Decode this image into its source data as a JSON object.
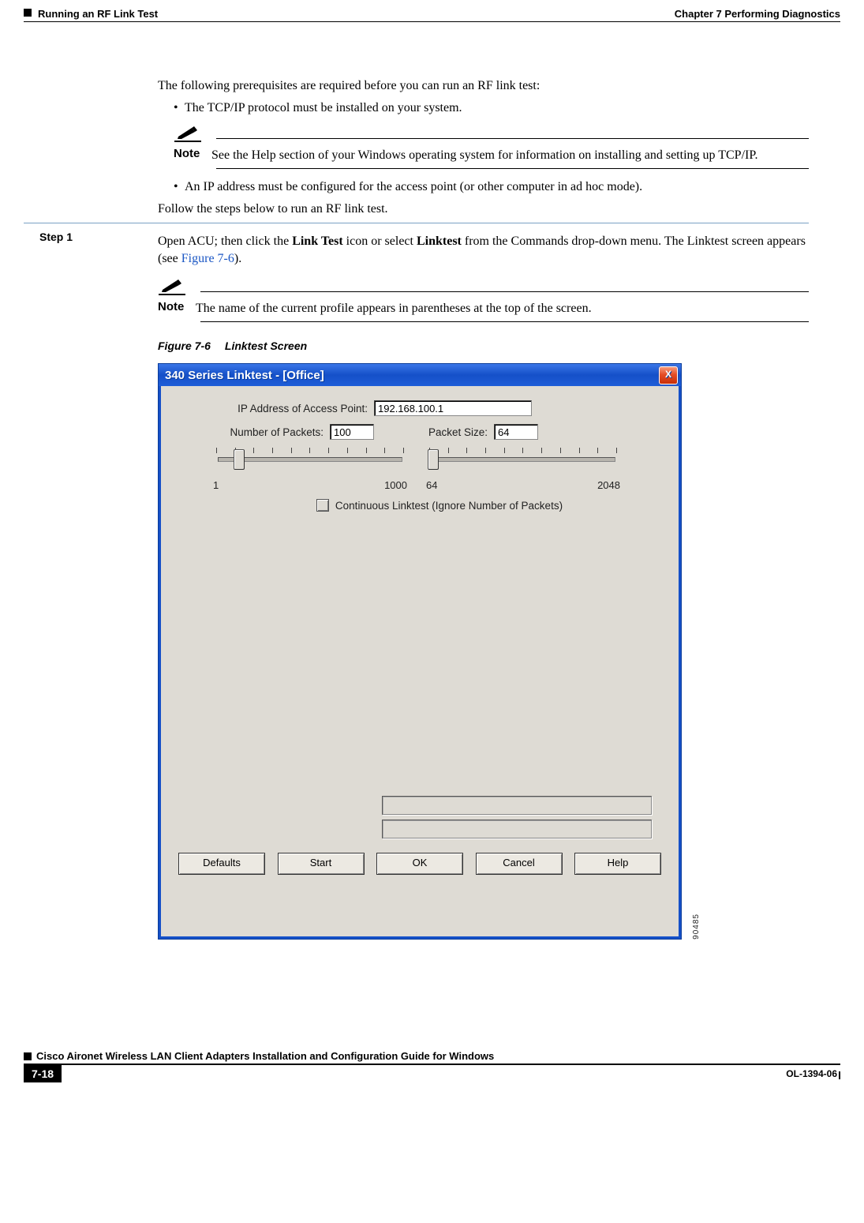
{
  "header": {
    "chapter": "Chapter 7      Performing Diagnostics",
    "section": "Running an RF Link Test"
  },
  "body": {
    "intro": "The following prerequisites are required before you can run an RF link test:",
    "bullet1": "The TCP/IP protocol must be installed on your system.",
    "note1_label": "Note",
    "note1_text": "See the Help section of your Windows operating system for information on installing and setting up TCP/IP.",
    "bullet2": "An IP address must be configured for the access point (or other computer in ad hoc mode).",
    "follow": "Follow the steps below to run an RF link test.",
    "step1_label": "Step 1",
    "step1_text_a": "Open ACU; then click the ",
    "step1_bold_a": "Link Test",
    "step1_text_b": " icon or select ",
    "step1_bold_b": "Linktest",
    "step1_text_c": " from the Commands drop-down menu. The Linktest screen appears (see ",
    "step1_figref": "Figure 7-6",
    "step1_text_d": ").",
    "note2_label": "Note",
    "note2_text": "The name of the current profile appears in parentheses at the top of the screen.",
    "figcap_num": "Figure 7-6",
    "figcap_title": "Linktest Screen",
    "figure_id": "90485"
  },
  "window": {
    "title": "340 Series Linktest - [Office]",
    "close": "X",
    "labels": {
      "ip": "IP Address of Access Point:",
      "numpackets": "Number of Packets:",
      "packetsize": "Packet Size:",
      "continuous": "Continuous Linktest (Ignore Number of Packets)"
    },
    "values": {
      "ip": "192.168.100.1",
      "numpackets": "100",
      "packetsize": "64"
    },
    "slider_packets": {
      "min": "1",
      "max": "1000"
    },
    "slider_size": {
      "min": "64",
      "max": "2048"
    },
    "buttons": {
      "defaults": "Defaults",
      "start": "Start",
      "ok": "OK",
      "cancel": "Cancel",
      "help": "Help"
    }
  },
  "footer": {
    "title": "Cisco Aironet Wireless LAN Client Adapters Installation and Configuration Guide for Windows",
    "page": "7-18",
    "docid": "OL-1394-06"
  }
}
